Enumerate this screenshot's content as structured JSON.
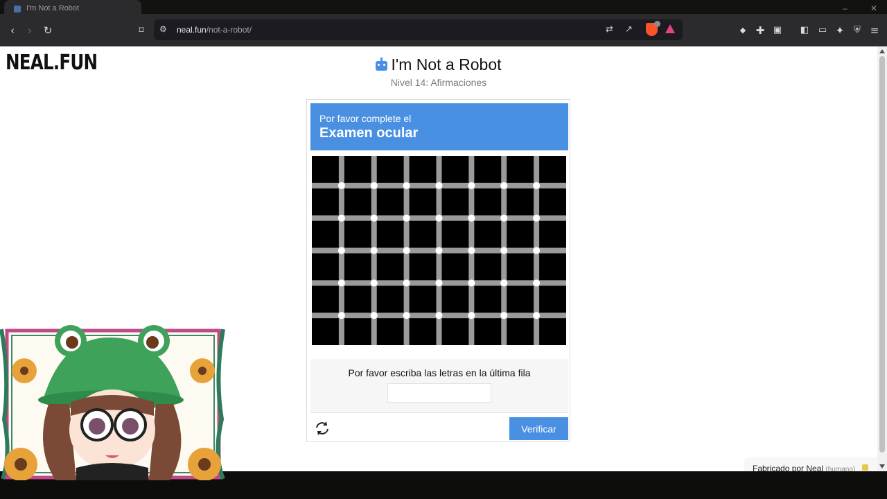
{
  "browser": {
    "tab_title": "I'm Not a Robot",
    "url_domain": "neal.fun",
    "url_path": "/not-a-robot/",
    "colors": {
      "chrome": "#2b2b2e",
      "urlbar": "#1c1b22",
      "brave": "#fb542b"
    }
  },
  "page": {
    "logo": "NEAL.FUN",
    "title": "I'm Not a Robot",
    "subtitle": "Nivel 14: Afirmaciones",
    "accent": "#4a90e2",
    "credit_prefix": "Fabricado por Neal",
    "credit_suffix": "(humano)"
  },
  "captcha": {
    "header_line1": "Por favor complete el",
    "header_line2": "Examen ocular",
    "prompt": "Por favor escriba las letras en la última fila",
    "answer_value": "",
    "verify_label": "Verificar",
    "grid": {
      "columns": 8,
      "rows": 6,
      "cell_color": "#000000",
      "line_color": "#9a9a9a",
      "dot_color": "#ffffff"
    }
  },
  "overlay": {
    "description": "Streamer avatar overlay: frog hat, glasses, sunflowers"
  }
}
